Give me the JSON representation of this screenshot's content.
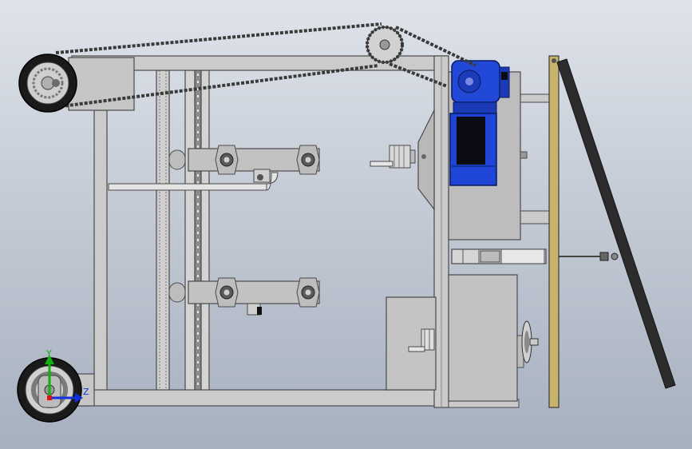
{
  "view": {
    "triad": {
      "axis_y_label": "Y",
      "axis_z_label": "Z",
      "axis_x_color": "#e01010",
      "axis_y_color": "#10b010",
      "axis_z_color": "#1030e0"
    }
  },
  "colors": {
    "frame": "#c9c9c9",
    "frame_edge": "#4a4a4a",
    "motor_blue": "#1f45d6",
    "motor_dark": "#0b0b14",
    "board_olive": "#c8b46a",
    "strip_dark": "#2c2c2c",
    "chain": "#3a3a3a"
  }
}
